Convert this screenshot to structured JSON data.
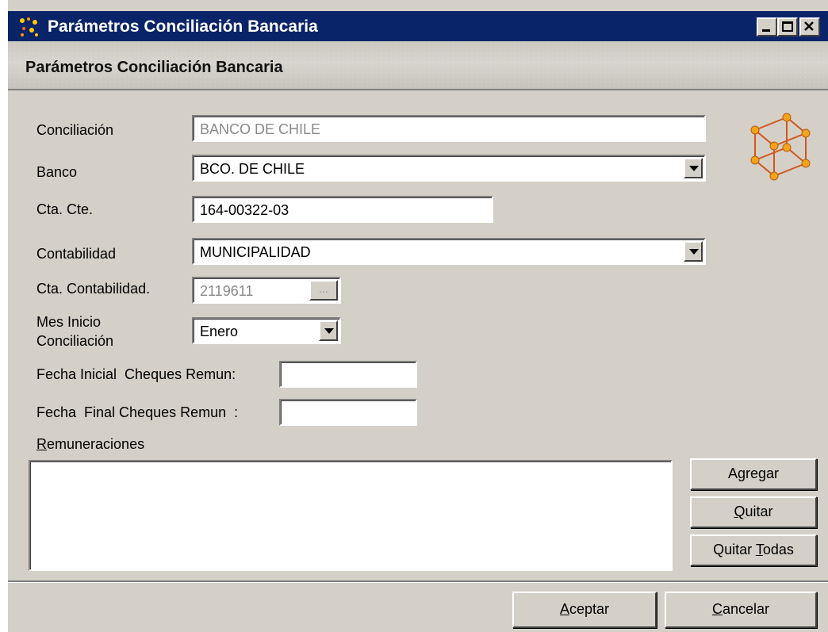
{
  "window": {
    "title": "Parámetros Conciliación Bancaria",
    "header_title": "Parámetros Conciliación Bancaria"
  },
  "form": {
    "conciliacion": {
      "label": "Conciliación",
      "value": "BANCO DE CHILE"
    },
    "banco": {
      "label": "Banco",
      "value": "BCO. DE CHILE"
    },
    "cta_cte": {
      "label": "Cta. Cte.",
      "value": "164-00322-03"
    },
    "contabilidad": {
      "label": "Contabilidad",
      "value": "MUNICIPALIDAD"
    },
    "cta_contabilidad": {
      "label": "Cta. Contabilidad.",
      "value": "2119611",
      "browse_label": "..."
    },
    "mes_inicio": {
      "label_line1": "Mes Inicio",
      "label_line2": "Conciliación",
      "value": "Enero"
    },
    "fecha_inicial": {
      "label": "Fecha Inicial  Cheques Remun:",
      "value": ""
    },
    "fecha_final": {
      "label": "Fecha  Final Cheques Remun  :",
      "value": ""
    },
    "remuneraciones": {
      "label_prefix": "R",
      "label_rest": "emuneraciones"
    }
  },
  "buttons": {
    "agregar": {
      "prefix": "A",
      "underline": "g",
      "rest": "regar"
    },
    "quitar": {
      "prefix": "",
      "underline": "Q",
      "rest": "uitar"
    },
    "quitar_todas": {
      "prefix": "Quitar ",
      "underline": "T",
      "rest": "odas"
    },
    "aceptar": {
      "prefix": "",
      "underline": "A",
      "rest": "ceptar"
    },
    "cancelar": {
      "prefix": "",
      "underline": "C",
      "rest": "ancelar"
    }
  },
  "icons": {
    "app_icon": "cube-icon",
    "window_minimize": "minimize-icon",
    "window_restore": "restore-icon",
    "window_close": "close-icon"
  },
  "colors": {
    "titlebar": "#0a246a",
    "face": "#d4d0c8",
    "disabled_text": "#8a8a8a",
    "cube": "#e07a1a"
  }
}
